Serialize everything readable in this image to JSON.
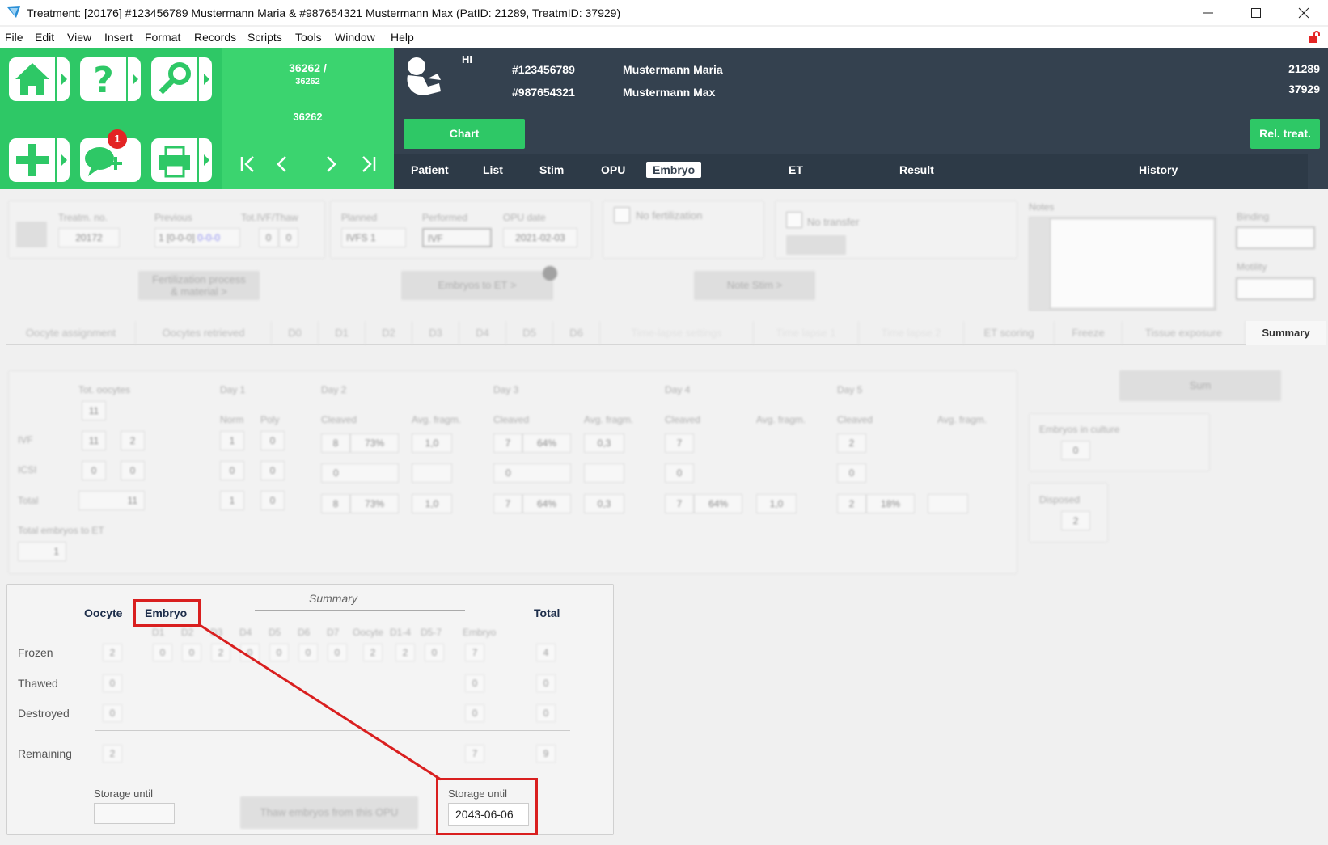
{
  "window": {
    "title": "Treatment: [20176] #123456789 Mustermann Maria & #987654321 Mustermann Max  (PatID: 21289,  TreatmID: 37929)"
  },
  "menu": [
    "File",
    "Edit",
    "View",
    "Insert",
    "Format",
    "Records",
    "Scripts",
    "Tools",
    "Window",
    "Help"
  ],
  "nav": {
    "notification_count": "1",
    "record_line1": "36262 /",
    "record_line2": "36262",
    "record_line3": "36262"
  },
  "header": {
    "initials": "HI",
    "patient1_id": "#123456789",
    "patient1_name": "Mustermann Maria",
    "patient2_id": "#987654321",
    "patient2_name": "Mustermann Max",
    "pat_id": "21289",
    "treatm_id": "37929",
    "chart_button": "Chart",
    "rel_treat_button": "Rel. treat.",
    "tabs": [
      "Patient",
      "List",
      "Stim",
      "OPU",
      "Embryo",
      "ET",
      "Result",
      "History"
    ],
    "active_tab": "Embryo"
  },
  "treatment": {
    "treatm_no_label": "Treatm. no.",
    "treatm_no": "20172",
    "previous_label": "Previous",
    "previous_value": "1 [0-0-0]",
    "previous_link": "0-0-0",
    "tot_ivf_thaw_label": "Tot.IVF/Thaw",
    "tot_ivf": "0",
    "tot_thaw": "0",
    "planned_label": "Planned",
    "planned": "IVFS 1",
    "performed_label": "Performed",
    "performed": "IVF",
    "opu_date_label": "OPU date",
    "opu_date": "2021-02-03",
    "no_fertilization": "No fertilization",
    "no_transfer": "No transfer",
    "notes_label": "Notes",
    "binding_label": "Binding",
    "motility_label": "Motility",
    "fert_button_line1": "Fertilization process",
    "fert_button_line2": "& material >",
    "embryos_to_et_button": "Embryos to ET >",
    "note_stim_button": "Note Stim >"
  },
  "subtabs": [
    "Oocyte assignment",
    "Oocytes retrieved",
    "D0",
    "D1",
    "D2",
    "D3",
    "D4",
    "D5",
    "D6",
    "Time-lapse settings",
    "Time lapse 1",
    "Time lapse 2",
    "ET scoring",
    "Freeze",
    "Tissue exposure",
    "Summary"
  ],
  "active_subtab": "Summary",
  "stats": {
    "tot_oocytes_label": "Tot. oocytes",
    "tot_oocytes": "11",
    "day_labels": [
      "Day 1",
      "Day 2",
      "Day 3",
      "Day 4",
      "Day 5"
    ],
    "norm_label": "Norm",
    "poly_label": "Poly",
    "cleaved_label": "Cleaved",
    "avg_fragm_label": "Avg. fragm.",
    "row_labels": [
      "IVF",
      "ICSI",
      "Total"
    ],
    "total_embryos_to_et_label": "Total embryos to ET",
    "total_embryos_to_et": "1",
    "sum_button": "Sum",
    "embryos_in_culture_label": "Embryos in culture",
    "embryos_in_culture": "0",
    "disposed_label": "Disposed",
    "disposed": "2",
    "ivf_row": [
      "11",
      "2",
      "1",
      "0",
      "8",
      "73%",
      "1,0",
      "7",
      "64%",
      "0,3",
      "7",
      "2"
    ],
    "icsi_row": [
      "0",
      "0",
      "0",
      "0",
      "0",
      "0",
      "0",
      "0"
    ],
    "total_row": [
      "11",
      "1",
      "0",
      "8",
      "73%",
      "1,0",
      "7",
      "64%",
      "0,3",
      "7",
      "64%",
      "1,0",
      "2",
      "18%"
    ]
  },
  "summary": {
    "title": "Summary",
    "oocyte_label": "Oocyte",
    "embryo_label": "Embryo",
    "total_label": "Total",
    "col_labels": [
      "D1",
      "D2",
      "D3",
      "D4",
      "D5",
      "D6",
      "D7",
      "Oocyte",
      "D1-4",
      "D5-7",
      "Embryo"
    ],
    "rows": [
      {
        "label": "Frozen",
        "oocyte": "2",
        "days": [
          "0",
          "0",
          "2",
          "0",
          "0",
          "0",
          "0"
        ],
        "oocyte2": "2",
        "d14": "2",
        "d57": "0",
        "embryo": "7",
        "total": "4"
      },
      {
        "label": "Thawed",
        "oocyte": "0",
        "embryo": "0",
        "total": "0"
      },
      {
        "label": "Destroyed",
        "oocyte": "0",
        "embryo": "0",
        "total": "0"
      },
      {
        "label": "Remaining",
        "oocyte": "2",
        "embryo": "7",
        "total": "9"
      }
    ],
    "storage_until_label": "Storage until",
    "storage_until_oocyte": "",
    "thaw_button": "Thaw embryos from this OPU",
    "storage_until_embryo_label": "Storage until",
    "storage_until_embryo": "2043-06-06"
  },
  "colors": {
    "green": "#2ec866",
    "dark": "#34414f",
    "annotation": "#d91f1f"
  }
}
